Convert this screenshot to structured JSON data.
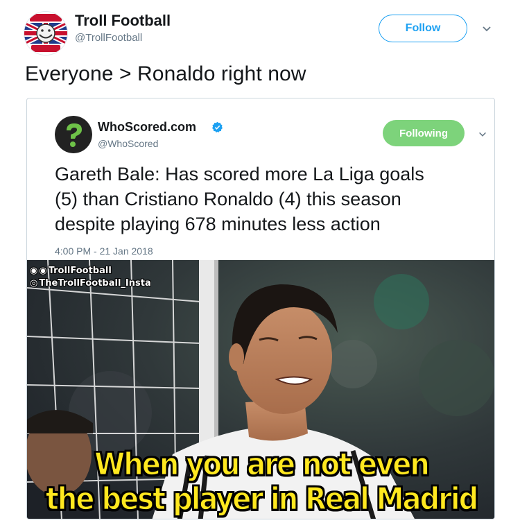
{
  "tweet": {
    "author_name": "Troll Football",
    "author_handle": "@TrollFootball",
    "follow_label": "Follow",
    "text": "Everyone > Ronaldo right now"
  },
  "quoted": {
    "author_name": "WhoScored.com",
    "author_handle": "@WhoScored",
    "following_label": "Following",
    "lines": [
      "Gareth Bale: Has scored more La Liga goals",
      "(5) than Cristiano Ronaldo (4) this season",
      "despite playing 678 minutes less action"
    ],
    "timestamp": "4:00 PM - 21 Jan 2018",
    "verified": true
  },
  "meme": {
    "watermark_1": "TrollFootball",
    "watermark_2": "TheTrollFootball_Insta",
    "caption_1": "When you are not even",
    "caption_2": "the best player in Real Madrid"
  },
  "colors": {
    "follow_blue": "#1da1f2",
    "following_green": "#7dd37b",
    "caption_yellow": "#ffe81f",
    "verified_blue": "#1da1f2"
  }
}
